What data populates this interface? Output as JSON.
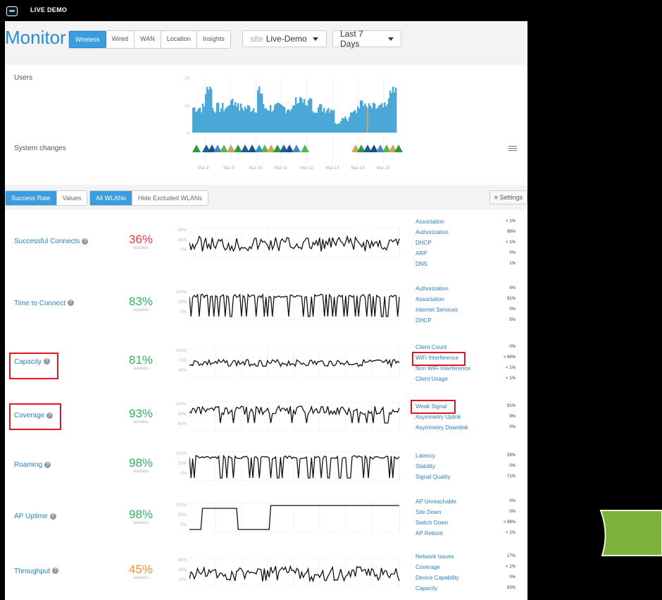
{
  "app": {
    "title": "LIVE DEMO"
  },
  "header": {
    "title": "Monitor",
    "tabs": [
      "Wireless",
      "Wired",
      "WAN",
      "Location",
      "Insights"
    ],
    "site_prefix": "site",
    "site_value": "Live-Demo",
    "range": "Last 7 Days"
  },
  "overview": {
    "users_label": "Users",
    "changes_label": "System changes",
    "y_ticks": [
      "20",
      "10",
      "0"
    ],
    "x_ticks": [
      "Mar-8",
      "Mar-9",
      "Mar-10",
      "Mar-11",
      "Mar-12",
      "Mar-13",
      "Mar-14",
      "Mar-15"
    ]
  },
  "toolbar": {
    "mode": [
      "Success Rate",
      "Values"
    ],
    "wlan": [
      "All WLANs",
      "Hide Excluded WLANs"
    ],
    "settings": "Settings"
  },
  "metrics": [
    {
      "name": "Successful Connects",
      "pct": "36%",
      "sub": "success",
      "color": "red",
      "ticks": [
        "80%",
        "40%",
        "0%"
      ],
      "reasons": [
        [
          "Association",
          "< 1%"
        ],
        [
          "Authorization",
          "99%"
        ],
        [
          "DHCP",
          "< 1%"
        ],
        [
          "ARP",
          "0%"
        ],
        [
          "DNS",
          "1%"
        ]
      ]
    },
    {
      "name": "Time to Connect",
      "pct": "83%",
      "sub": "success",
      "color": "green",
      "ticks": [
        "100%",
        "50%",
        "0%"
      ],
      "reasons": [
        [
          "Authorization",
          "4%"
        ],
        [
          "Association",
          "91%"
        ],
        [
          "Internet Services",
          "0%"
        ],
        [
          "DHCP",
          "5%"
        ]
      ]
    },
    {
      "name": "Capacity",
      "pct": "81%",
      "sub": "success",
      "color": "green",
      "ticks": [
        "100%",
        "70%",
        "40%"
      ],
      "reasons": [
        [
          "Client Count",
          "0%"
        ],
        [
          "WiFi Interference",
          "> 99%"
        ],
        [
          "Non WiFi Interference",
          "< 1%"
        ],
        [
          "Client Usage",
          "< 1%"
        ]
      ]
    },
    {
      "name": "Coverage",
      "pct": "93%",
      "sub": "success",
      "color": "green",
      "ticks": [
        "100%",
        "80%",
        "60%"
      ],
      "reasons": [
        [
          "Weak Signal",
          "91%"
        ],
        [
          "Asymmetry Uplink",
          "9%"
        ],
        [
          "Asymmetry Downlink",
          "0%"
        ]
      ]
    },
    {
      "name": "Roaming",
      "pct": "98%",
      "sub": "success",
      "color": "green",
      "ticks": [
        "100%",
        "50%",
        "0%"
      ],
      "reasons": [
        [
          "Latency",
          "29%"
        ],
        [
          "Stability",
          "0%"
        ],
        [
          "Signal Quality",
          "71%"
        ]
      ]
    },
    {
      "name": "AP Uptime",
      "pct": "98%",
      "sub": "success",
      "color": "green",
      "ticks": [
        "100%",
        "50%",
        "0%"
      ],
      "reasons": [
        [
          "AP Unreachable",
          "0%"
        ],
        [
          "Site Down",
          "0%"
        ],
        [
          "Switch Down",
          "> 99%"
        ],
        [
          "AP Reboot",
          "< 1%"
        ]
      ]
    },
    {
      "name": "Throughput",
      "pct": "45%",
      "sub": "success",
      "color": "orange",
      "ticks": [
        "80%",
        "45%",
        "10%"
      ],
      "reasons": [
        [
          "Network Issues",
          "17%"
        ],
        [
          "Coverage",
          "< 1%"
        ],
        [
          "Device Capability",
          "0%"
        ],
        [
          "Capacity",
          "83%"
        ]
      ]
    }
  ],
  "colors": {
    "accent": "#3a9de0",
    "bars": "#4aa8d8",
    "highlight": "#e3141e",
    "arrow": "#7db33a"
  }
}
